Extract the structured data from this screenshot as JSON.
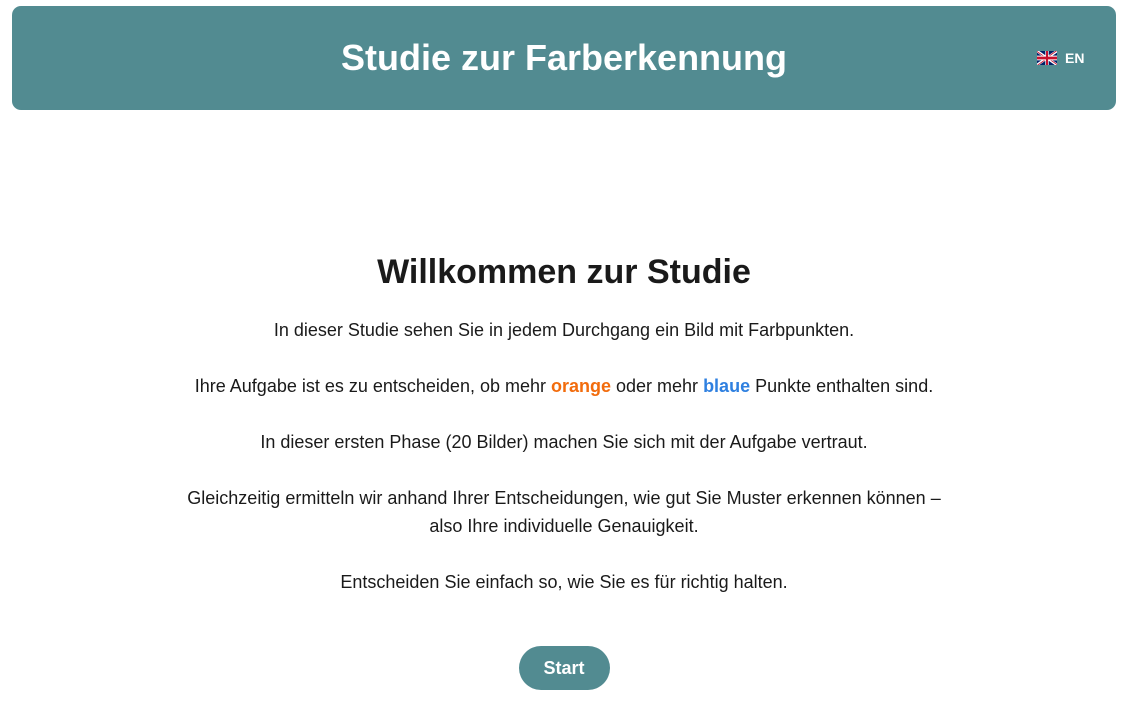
{
  "header": {
    "title": "Studie zur Farberkennung",
    "language": {
      "label": "EN",
      "icon": "uk-flag-icon"
    }
  },
  "main": {
    "heading": "Willkommen zur Studie",
    "paragraph1": "In dieser Studie sehen Sie in jedem Durchgang ein Bild mit Farbpunkten.",
    "paragraph2": {
      "before": "Ihre Aufgabe ist es zu entscheiden, ob mehr ",
      "orange": "orange",
      "middle": " oder mehr ",
      "blue": "blaue",
      "after": " Punkte enthalten sind."
    },
    "paragraph3": "In dieser ersten Phase (20 Bilder) machen Sie sich mit der Aufgabe vertraut.",
    "paragraph4": "Gleichzeitig ermitteln wir anhand Ihrer Entscheidungen, wie gut Sie Muster erkennen können – also Ihre individuelle Genauigkeit.",
    "paragraph5": "Entscheiden Sie einfach so, wie Sie es für richtig halten.",
    "start_label": "Start"
  },
  "colors": {
    "accent": "#528b91",
    "orange": "#f26c0d",
    "blue": "#2f80e0"
  }
}
